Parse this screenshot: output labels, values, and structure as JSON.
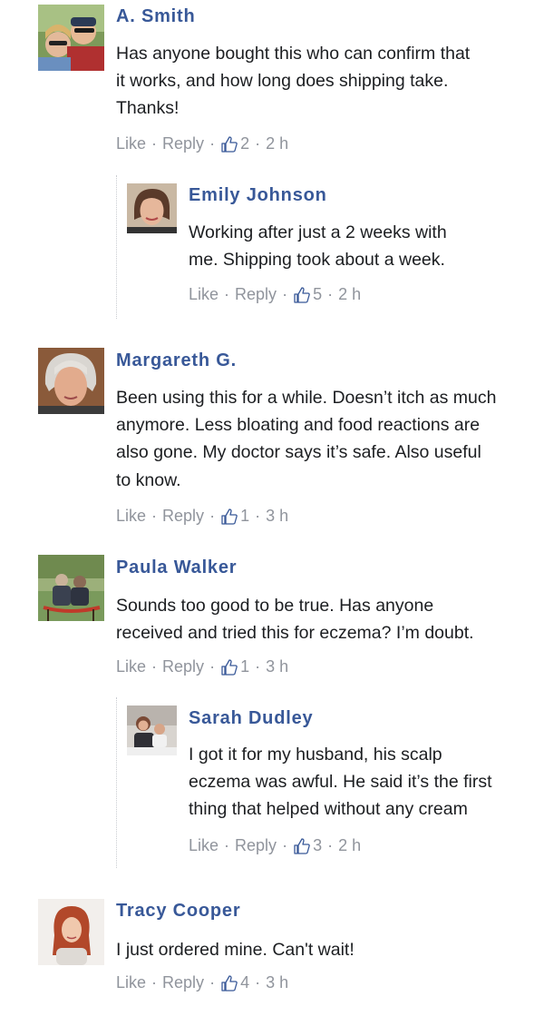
{
  "comments": [
    {
      "author": "A. Smith",
      "lines": [
        "Has anyone bought this who can confirm that",
        "it works, and how long does shipping take.",
        "Thanks!"
      ],
      "like_label": "Like",
      "reply_label": "Reply",
      "likes": "2",
      "time": "2 h"
    },
    {
      "author": "Emily Johnson",
      "lines": [
        "Working after just a 2 weeks with",
        "me. Shipping took about a week."
      ],
      "like_label": "Like",
      "reply_label": "Reply",
      "likes": "5",
      "time": "2 h"
    },
    {
      "author": "Margareth G.",
      "lines": [
        "Been using this for a while. Doesn’t itch as much",
        "anymore. Less bloating and food reactions are",
        "also gone. My doctor says it’s safe. Also useful",
        "to know."
      ],
      "like_label": "Like",
      "reply_label": "Reply",
      "likes": "1",
      "time": "3 h"
    },
    {
      "author": "Paula Walker",
      "lines": [
        "Sounds too good to be true. Has anyone",
        "received and tried this for eczema? I’m doubt."
      ],
      "like_label": "Like",
      "reply_label": "Reply",
      "likes": "1",
      "time": "3 h"
    },
    {
      "author": "Sarah Dudley",
      "lines": [
        "I got it for my husband, his scalp",
        "eczema was awful. He said it’s the first",
        "thing that helped without any cream"
      ],
      "like_label": "Like",
      "reply_label": "Reply",
      "likes": "3",
      "time": "2 h"
    },
    {
      "author": "Tracy Cooper",
      "lines": [
        "I just ordered mine. Can't wait!"
      ],
      "like_label": "Like",
      "reply_label": "Reply",
      "likes": "4",
      "time": "3 h"
    }
  ],
  "separator": "·",
  "colors": {
    "author_name": "#385898",
    "action_text": "#90949c",
    "body_text": "#1c1e21"
  },
  "icons": {
    "like_count": "thumbs-up-icon"
  }
}
